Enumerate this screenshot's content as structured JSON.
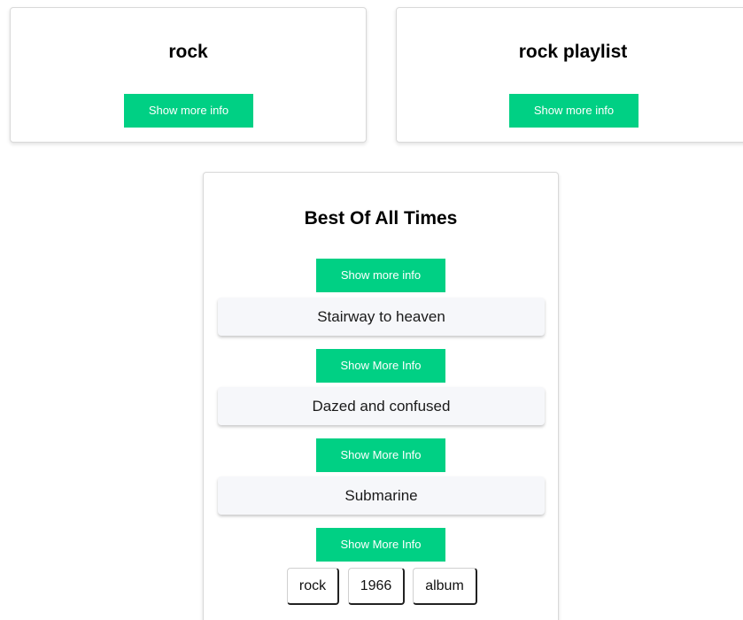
{
  "cards": [
    {
      "title": "rock",
      "button_label": "Show more info"
    },
    {
      "title": "rock playlist",
      "button_label": "Show more info"
    }
  ],
  "playlist": {
    "title": "Best Of All Times",
    "button_label": "Show more info",
    "songs": [
      {
        "name": "Stairway to heaven",
        "button_label": "Show More Info"
      },
      {
        "name": "Dazed and confused",
        "button_label": "Show More Info"
      },
      {
        "name": "Submarine",
        "button_label": "Show More Info"
      }
    ],
    "tags": [
      "rock",
      "1966",
      "album"
    ]
  },
  "colors": {
    "accent": "#00d084",
    "song_background": "#f6f7fa",
    "card_border": "#d9d9d9"
  }
}
